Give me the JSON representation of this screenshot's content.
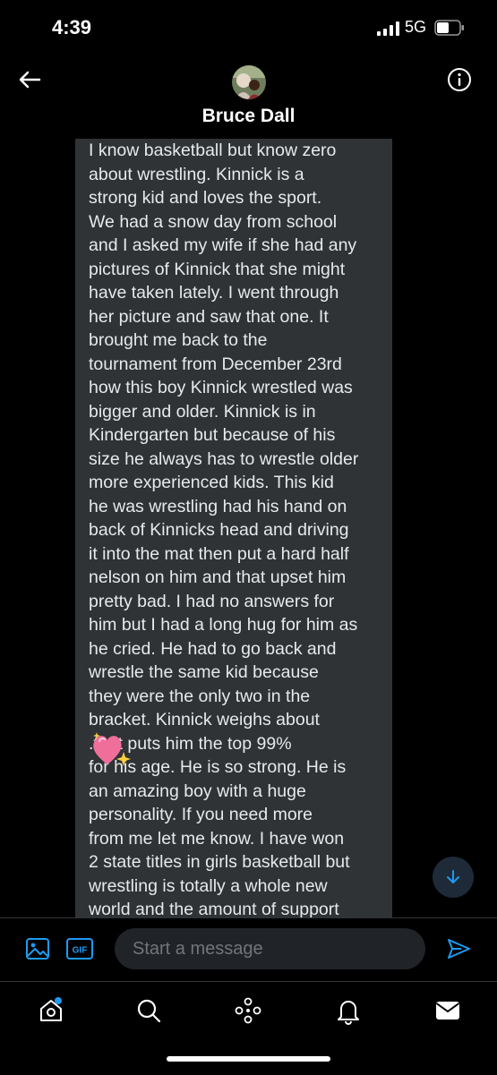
{
  "status_bar": {
    "time": "4:39",
    "network": "5G"
  },
  "header": {
    "name": "Bruce Dall",
    "back_icon": "back-arrow-icon",
    "info_icon": "info-icon"
  },
  "message": {
    "text": "I know basketball but know zero\nabout wrestling.  Kinnick is a\nstrong kid and loves the sport.\nWe had a snow day from school\nand I asked my wife if she had any\npictures of Kinnick that she might\nhave taken lately.  I went through\nher picture and saw that one.  It\nbrought me back to the\ntournament from December 23rd\nhow this boy Kinnick wrestled was\nbigger and older.  Kinnick is in\nKindergarten but because of his\nsize he always has to wrestle older\nmore experienced kids.  This kid\nhe was wrestling had his hand on\nback of Kinnicks head and driving\nit into the mat then put a hard half\nnelson on him and that upset him\npretty bad.  I had no answers for\nhim but I had a long hug for him as\nhe cried. He had to go back and\nwrestle the same kid because\nthey were the only two in the\nbracket.  Kinnick weighs about\n        .that puts him the top 99%\nfor his age.  He is so strong.  He is\nan amazing boy with a huge\npersonality.  If you need more\nfrom me let me know. I have won\n2 state titles in girls basketball but\nwrestling is totally a whole new\nworld and the amount of support",
    "emoji": "sparkling-heart-emoji"
  },
  "composer": {
    "placeholder": "Start a message",
    "gif_label": "GIF"
  },
  "nav": [
    "home-icon",
    "search-icon",
    "spaces-icon",
    "notifications-icon",
    "messages-icon"
  ],
  "colors": {
    "accent": "#1d9bf0",
    "bubble": "#2f3336",
    "background": "#000000"
  }
}
